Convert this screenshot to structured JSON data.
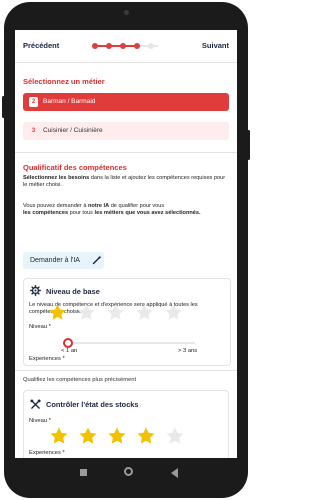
{
  "nav": {
    "prev_label": "Précédent",
    "next_label": "Suivant",
    "steps_total": 5,
    "steps_completed": 4
  },
  "jobs": {
    "heading": "Sélectionnez un métier",
    "items": [
      {
        "number": "2",
        "label": "Barman / Barmaid",
        "selected": true
      },
      {
        "number": "3",
        "label": "Cuisinier / Cuisinière",
        "selected": false
      }
    ]
  },
  "skills": {
    "heading": "Qualificatif des compétences",
    "intro_bold": "Sélectionnez les besoins",
    "intro_rest": " dans la liste et ajoutez les compétences requises pour le métier choisi.",
    "ai_text_1": "Vous pouvez demander à ",
    "ai_text_bold_1": "notre IA",
    "ai_text_2": " de qualifier pour vous ",
    "ai_text_bold_2": "les compétences",
    "ai_text_3": " pour tous ",
    "ai_text_bold_3": "les métiers que vous avez sélectionnés.",
    "ai_button": "Demander à l'IA"
  },
  "base_card": {
    "title": "Niveau de base",
    "description": "Le niveau de compétence et d'expérience sera appliqué à toutes les compétences choisies.",
    "level_label": "Niveau *",
    "level_value": 1,
    "level_max": 5,
    "experience_label": "Experiences *",
    "experience_min_label": "< 1 an",
    "experience_max_label": "> 3 ans",
    "experience_value": 0
  },
  "precise": {
    "heading": "Qualifiez les compétences plus précisément"
  },
  "stock_card": {
    "title": "Contrôler l'état des stocks",
    "level_label": "Niveau *",
    "level_value": 4,
    "level_max": 5,
    "experience_label": "Experiences *"
  },
  "colors": {
    "accent": "#d93030",
    "star_on": "#f2c200",
    "star_off": "#e9e9e9"
  }
}
